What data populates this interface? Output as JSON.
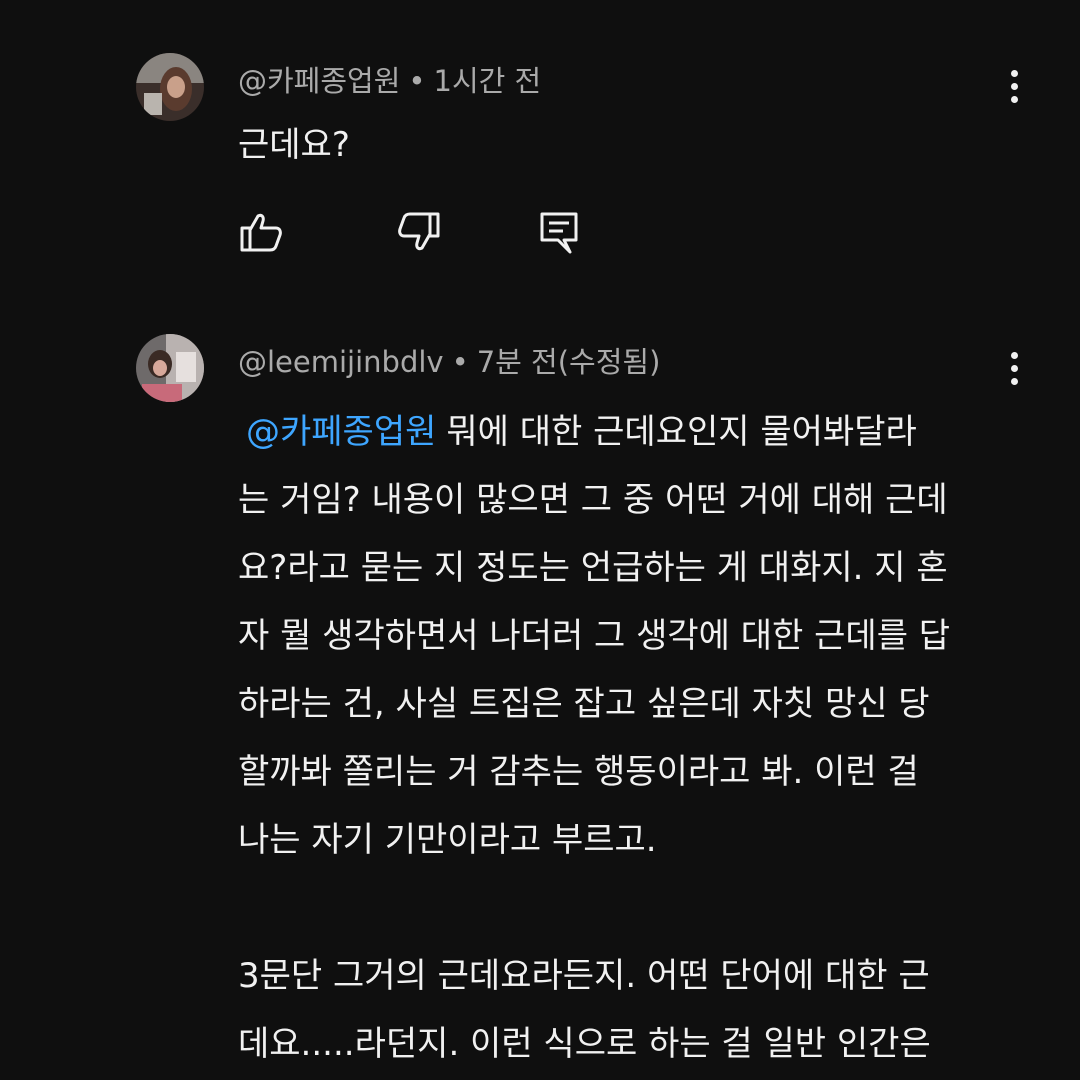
{
  "comments": [
    {
      "author": "@카페종업원",
      "time": "1시간 전",
      "text": "근데요?"
    },
    {
      "author": "@leemijinbdlv",
      "time": "7분 전(수정됨)",
      "mention": "@카페종업원",
      "lines": [
        "뭐에 대한 근데요인지 물어봐달라",
        "는 거임? 내용이 많으면 그 중 어떤 거에 대해 근데",
        "요?라고 묻는 지 정도는 언급하는 게 대화지. 지 혼",
        "자 뭘 생각하면서 나더러 그 생각에 대한 근데를 답",
        "하라는 건, 사실 트집은 잡고 싶은데 자칫 망신 당",
        "할까봐 쫄리는 거 감추는 행동이라고 봐. 이런 걸",
        "나는 자기 기만이라고 부르고.",
        "3문단 그거의 근데요라든지. 어떤 단어에 대한 근",
        "데요.....라던지. 이런 식으로 하는 걸 일반 인간은"
      ]
    }
  ],
  "separator": "•",
  "icons": {
    "like": "thumbs-up-icon",
    "dislike": "thumbs-down-icon",
    "reply": "reply-icon",
    "more": "more-vert-icon"
  },
  "colors": {
    "background": "#0f0f0f",
    "text": "#f1f1f1",
    "meta": "#aaaaaa",
    "mention": "#3ea6ff"
  }
}
